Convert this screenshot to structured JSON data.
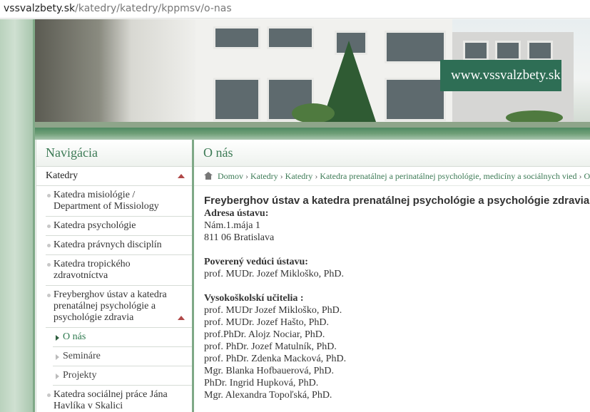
{
  "browser": {
    "url_host": "vssvalzbety.sk",
    "url_path": "/katedry/katedry/kppmsv/o-nas"
  },
  "banner": {
    "site_text": "www.vssvalzbety.sk"
  },
  "sidebar": {
    "title": "Navigácia",
    "top_item": "Katedry",
    "items": [
      {
        "label": "Katedra misiológie / Department of Missiology"
      },
      {
        "label": "Katedra psychológie"
      },
      {
        "label": "Katedra právnych disciplín"
      },
      {
        "label": "Katedra tropického zdravotníctva"
      },
      {
        "label": "Freyberghov ústav a katedra prenatálnej psychológie a psychológie zdravia"
      },
      {
        "label": "Katedra sociálnej práce Jána Havlíka v Skalici"
      }
    ],
    "subitems": [
      {
        "label": "O nás"
      },
      {
        "label": "Semináre"
      },
      {
        "label": "Projekty"
      }
    ]
  },
  "main": {
    "title": "O nás",
    "breadcrumb": [
      "Domov",
      "Katedry",
      "Katedry",
      "Katedra prenatálnej a perinatálnej psychológie, medicíny a sociálnych vied",
      "O"
    ],
    "heading": "Freyberghov ústav a katedra prenatálnej psychológie a psychológie zdravia",
    "address_label": "Adresa ústavu:",
    "address_lines": [
      "Nám.1.mája 1",
      "811 06 Bratislava"
    ],
    "head_label": "Poverený vedúci ústavu:",
    "head_name": "prof. MUDr. Jozef Mikloško, PhD.",
    "teachers_label": "Vysokoškolskí učitelia :",
    "teachers": [
      "prof. MUDr Jozef Mikloško, PhD.",
      "prof. MUDr. Jozef Hašto, PhD.",
      "prof.PhDr. Alojz Nociar, PhD.",
      "prof. PhDr. Jozef Matulník, PhD.",
      "prof. PhDr. Zdenka Macková, PhD.",
      "Mgr. Blanka Hofbauerová, PhD.",
      "PhDr. Ingrid Hupková, PhD.",
      "Mgr. Alexandra Topoľská, PhD."
    ]
  },
  "colors": {
    "accent_green": "#3c7a55",
    "badge_green": "#2e6e55",
    "arrow_red": "#b04848"
  }
}
